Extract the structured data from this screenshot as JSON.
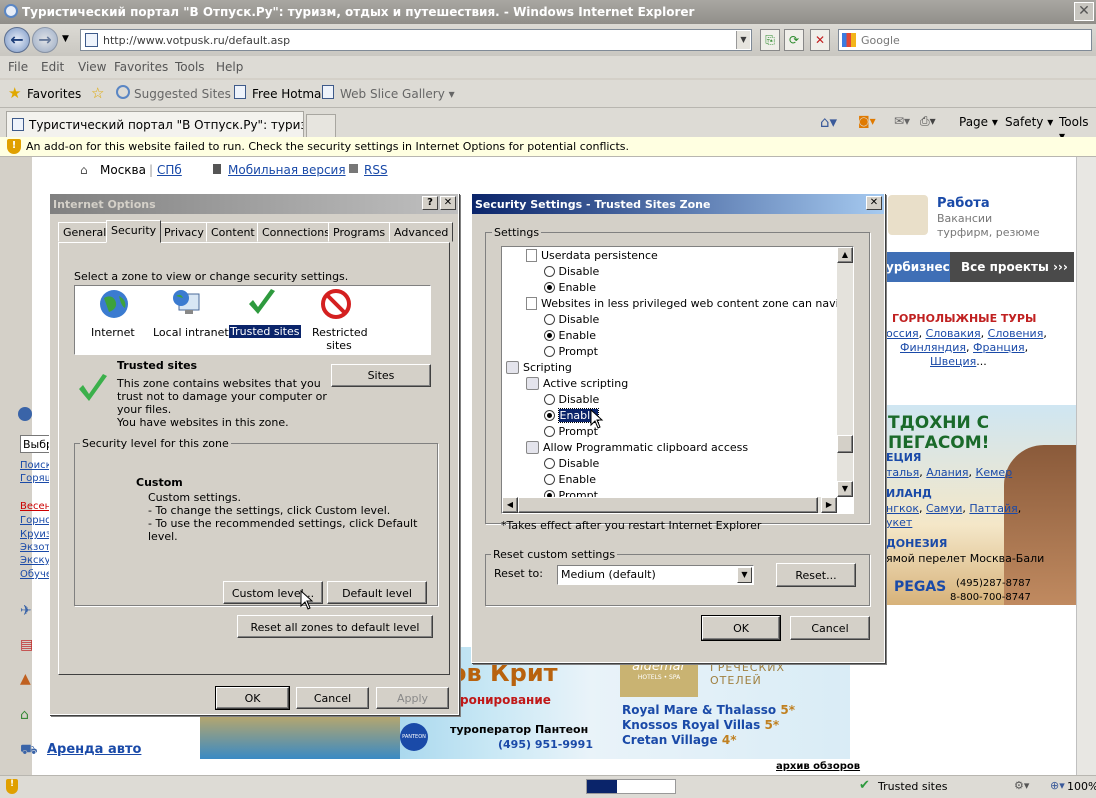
{
  "browser": {
    "window_title": "Туристический портал \"В Отпуск.Ру\": туризм, отдых и путешествия. - Windows Internet Explorer",
    "address": "http://www.votpusk.ru/default.asp",
    "search_placeholder": "Google",
    "menu": [
      "File",
      "Edit",
      "View",
      "Favorites",
      "Tools",
      "Help"
    ],
    "favorites_label": "Favorites",
    "suggested_sites": "Suggested Sites ▾",
    "free_hotmail": "Free Hotmail",
    "web_slice_gallery": "Web Slice Gallery ▾",
    "tab_title": "Туристический портал \"В Отпуск.Ру\": туризм, отд...",
    "commands": {
      "page": "Page ▾",
      "safety": "Safety ▾",
      "tools": "Tools ▾"
    },
    "infobar": "An add-on for this website failed to run. Check the security settings in Internet Options for potential conflicts.",
    "status_zone": "Trusted sites",
    "zoom": "100%"
  },
  "webpage": {
    "city_moscow": "Москва",
    "city_spb": "СПб",
    "mobile": "Мобильная версия",
    "rss": "RSS",
    "job_title": "Работа",
    "job_desc1": "Вакансии",
    "job_desc2": "турфирм, резюме",
    "biz_tab": "урбизнес",
    "all_projects": "Все проекты ›››",
    "ski_title": "ГОРНОЛЫЖНЫЕ ТУРЫ",
    "ski_row1": [
      "оссия",
      "Словакия",
      "Словения"
    ],
    "ski_row2": [
      "Финляндия",
      "Франция"
    ],
    "ski_row3": [
      "Швеция",
      "..."
    ],
    "pegas_headline": "ТДОХНИ С ПЕГАСОМ!",
    "pegas_greece": "ЕЦИЯ",
    "pegas_greece_links": [
      "талья",
      "Алания",
      "Кемер"
    ],
    "pegas_thai": "ИЛАНД",
    "pegas_thai_links": [
      "нгкок",
      "Самуи",
      "Паттайя"
    ],
    "pegas_thai_more": "укет",
    "pegas_indo": "ДОНЕЗИЯ",
    "pegas_indo_desc": "ямой перелет Москва-Бали",
    "pegas_brand": "PEGAS",
    "pegas_phone1": "(495)287-8787",
    "pegas_phone2": "8-800-700-8747",
    "left_items": [
      "Выбр",
      "Поиск",
      "Горящ",
      "Весен",
      "Горно",
      "Круиз",
      "Экзот",
      "Экску",
      "Обуче"
    ],
    "rent_car": "Аренда авто",
    "crete_title": "ов Крит",
    "crete_booking": "ронирование",
    "panteon_label": "туроператор Пантеон",
    "panteon_phone": "(495) 951-9991",
    "panteon_brand": "PANTEON",
    "aldemar_brand": "aldemar",
    "aldemar_sub": "HOTELS • SPA",
    "greek_hotels": "ГРЕЧЕСКИХ ОТЕЛЕЙ",
    "hotel1": "Royal Mare & Thalasso",
    "hotel1_stars": "5*",
    "hotel2": "Knossos Royal Villas",
    "hotel2_stars": "5*",
    "hotel3": "Cretan Village",
    "hotel3_stars": "4*",
    "archive": "архив обзоров"
  },
  "internet_options": {
    "title": "Internet Options",
    "tabs": [
      "General",
      "Security",
      "Privacy",
      "Content",
      "Connections",
      "Programs",
      "Advanced"
    ],
    "zone_prompt": "Select a zone to view or change security settings.",
    "zones": [
      "Internet",
      "Local intranet",
      "Trusted sites",
      "Restricted sites"
    ],
    "zone_heading": "Trusted sites",
    "zone_desc": [
      "This zone contains websites that you",
      "trust not to damage your computer or",
      "your files.",
      "You have websites in this zone."
    ],
    "sites_btn": "Sites",
    "level_group": "Security level for this zone",
    "level_title": "Custom",
    "level_desc": [
      "Custom settings.",
      "- To change the settings, click Custom level.",
      "- To use the recommended settings, click Default level."
    ],
    "custom_level_btn": "Custom level...",
    "default_level_btn": "Default level",
    "reset_all_btn": "Reset all zones to default level",
    "ok": "OK",
    "cancel": "Cancel",
    "apply": "Apply"
  },
  "security_settings": {
    "title": "Security Settings - Trusted Sites Zone",
    "settings_group": "Settings",
    "tree": {
      "userdata": "Userdata persistence",
      "userdata_opts": [
        "Disable",
        "Enable"
      ],
      "websites_less": "Websites in less privileged web content zone can navigate into",
      "websites_opts": [
        "Disable",
        "Enable",
        "Prompt"
      ],
      "scripting": "Scripting",
      "active_scripting": "Active scripting",
      "active_opts": [
        "Disable",
        "Enable",
        "Prompt"
      ],
      "clipboard": "Allow Programmatic clipboard access",
      "clipboard_opts": [
        "Disable",
        "Enable",
        "Prompt"
      ]
    },
    "note": "*Takes effect after you restart Internet Explorer",
    "reset_group": "Reset custom settings",
    "reset_to_label": "Reset to:",
    "reset_to_value": "Medium (default)",
    "reset_btn": "Reset...",
    "ok": "OK",
    "cancel": "Cancel"
  }
}
